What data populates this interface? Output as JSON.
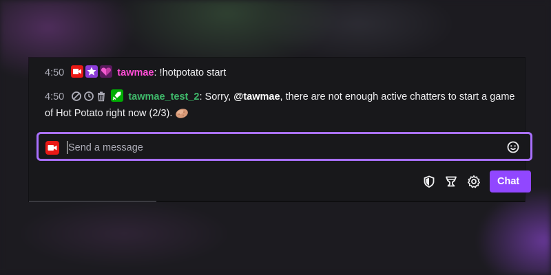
{
  "messages": [
    {
      "timestamp": "4:50",
      "badges": [
        "live-badge-icon",
        "vip-star-badge-icon",
        "subscriber-heart-badge-icon"
      ],
      "username": "tawmae",
      "separator": ":",
      "text": " !hotpotato start"
    },
    {
      "timestamp": "4:50",
      "mod_actions": [
        "ban-icon",
        "timeout-clock-icon",
        "delete-trash-icon"
      ],
      "badges": [
        "moderator-sword-badge-icon"
      ],
      "username": "tawmae_test_2",
      "separator": ":",
      "text_before": " Sorry, ",
      "mention": "@tawmae",
      "text_after": ", there are not enough active chatters to start a game of Hot Potato right now (2/3).",
      "emote": "potato-emote-icon"
    }
  ],
  "input": {
    "placeholder": "Send a message"
  },
  "toolbar": {
    "chat_button_label": "Chat"
  },
  "colors": {
    "accent": "#9147ff",
    "input_border": "#a970ff",
    "username_1": "#ff4dd6",
    "username_2": "#3fb86a",
    "live": "#e91916"
  }
}
